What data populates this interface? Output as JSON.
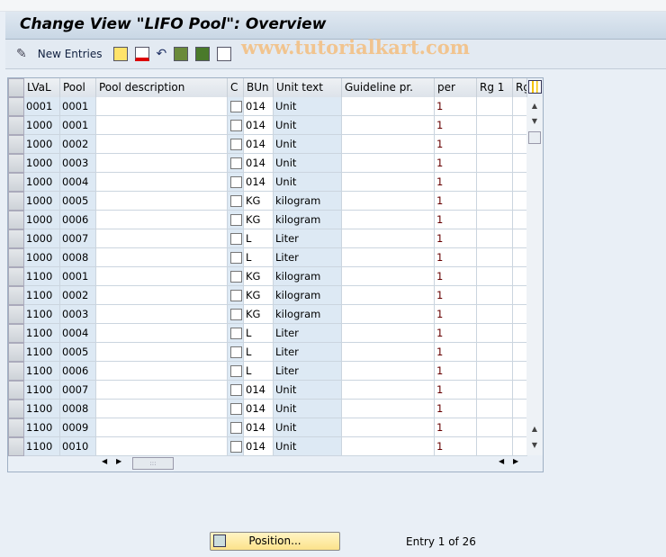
{
  "title": "Change View \"LIFO Pool\": Overview",
  "toolbar": {
    "new_entries": "New Entries",
    "icons": [
      "display-change-icon",
      "copy-icon",
      "delete-icon",
      "undo-icon",
      "select-all-icon",
      "select-block-icon",
      "deselect-all-icon"
    ]
  },
  "watermark": "www.tutorialkart.com",
  "table": {
    "columns": [
      "LVaL",
      "Pool",
      "Pool description",
      "C",
      "BUn",
      "Unit text",
      "Guideline pr.",
      "per",
      "Rg 1",
      "Rg"
    ],
    "rows": [
      [
        "0001",
        "0001",
        "",
        false,
        "014",
        "Unit",
        "",
        "1",
        "",
        ""
      ],
      [
        "1000",
        "0001",
        "",
        false,
        "014",
        "Unit",
        "",
        "1",
        "",
        ""
      ],
      [
        "1000",
        "0002",
        "",
        false,
        "014",
        "Unit",
        "",
        "1",
        "",
        ""
      ],
      [
        "1000",
        "0003",
        "",
        false,
        "014",
        "Unit",
        "",
        "1",
        "",
        ""
      ],
      [
        "1000",
        "0004",
        "",
        false,
        "014",
        "Unit",
        "",
        "1",
        "",
        ""
      ],
      [
        "1000",
        "0005",
        "",
        false,
        "KG",
        "kilogram",
        "",
        "1",
        "",
        ""
      ],
      [
        "1000",
        "0006",
        "",
        false,
        "KG",
        "kilogram",
        "",
        "1",
        "",
        ""
      ],
      [
        "1000",
        "0007",
        "",
        false,
        "L",
        "Liter",
        "",
        "1",
        "",
        ""
      ],
      [
        "1000",
        "0008",
        "",
        false,
        "L",
        "Liter",
        "",
        "1",
        "",
        ""
      ],
      [
        "1100",
        "0001",
        "",
        false,
        "KG",
        "kilogram",
        "",
        "1",
        "",
        ""
      ],
      [
        "1100",
        "0002",
        "",
        false,
        "KG",
        "kilogram",
        "",
        "1",
        "",
        ""
      ],
      [
        "1100",
        "0003",
        "",
        false,
        "KG",
        "kilogram",
        "",
        "1",
        "",
        ""
      ],
      [
        "1100",
        "0004",
        "",
        false,
        "L",
        "Liter",
        "",
        "1",
        "",
        ""
      ],
      [
        "1100",
        "0005",
        "",
        false,
        "L",
        "Liter",
        "",
        "1",
        "",
        ""
      ],
      [
        "1100",
        "0006",
        "",
        false,
        "L",
        "Liter",
        "",
        "1",
        "",
        ""
      ],
      [
        "1100",
        "0007",
        "",
        false,
        "014",
        "Unit",
        "",
        "1",
        "",
        ""
      ],
      [
        "1100",
        "0008",
        "",
        false,
        "014",
        "Unit",
        "",
        "1",
        "",
        ""
      ],
      [
        "1100",
        "0009",
        "",
        false,
        "014",
        "Unit",
        "",
        "1",
        "",
        ""
      ],
      [
        "1100",
        "0010",
        "",
        false,
        "014",
        "Unit",
        "",
        "1",
        "",
        ""
      ]
    ]
  },
  "footer": {
    "position_button": "Position...",
    "entry_info": "Entry 1 of 26"
  }
}
